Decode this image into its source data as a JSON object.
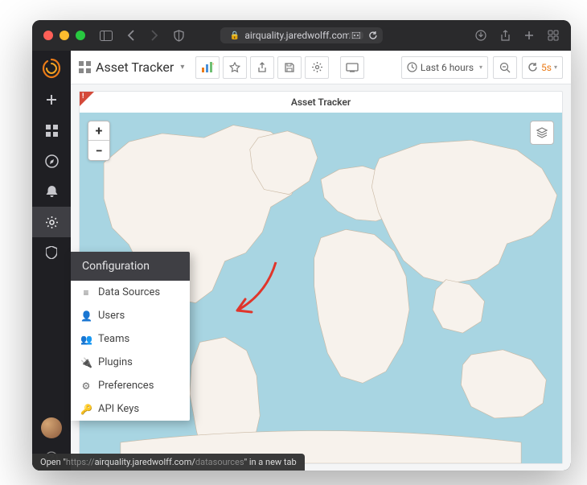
{
  "browser": {
    "url_display": "airquality.jaredwolff.com",
    "status_tip_prefix": "Open \"",
    "status_tip_url_scheme": "https://",
    "status_tip_host": "airquality.jaredwolff.com/",
    "status_tip_path": "datasources",
    "status_tip_suffix": "\" in a new tab"
  },
  "dashboard": {
    "breadcrumb_title": "Asset Tracker",
    "panel_title": "Asset Tracker"
  },
  "toolbar": {
    "time_range": "Last 6 hours",
    "refresh_interval": "5s"
  },
  "sidebar": {
    "flyout_title": "Configuration",
    "items": [
      {
        "label": "Data Sources",
        "icon": "database-icon"
      },
      {
        "label": "Users",
        "icon": "user-icon"
      },
      {
        "label": "Teams",
        "icon": "team-icon"
      },
      {
        "label": "Plugins",
        "icon": "plug-icon"
      },
      {
        "label": "Preferences",
        "icon": "sliders-icon"
      },
      {
        "label": "API Keys",
        "icon": "key-icon"
      }
    ]
  },
  "map": {
    "zoom_in": "+",
    "zoom_out": "−"
  },
  "colors": {
    "accent_orange": "#eb7b18",
    "panel_alert": "#d44a3a",
    "map_water": "#a8d5e2",
    "map_land": "#f7f2ec"
  }
}
